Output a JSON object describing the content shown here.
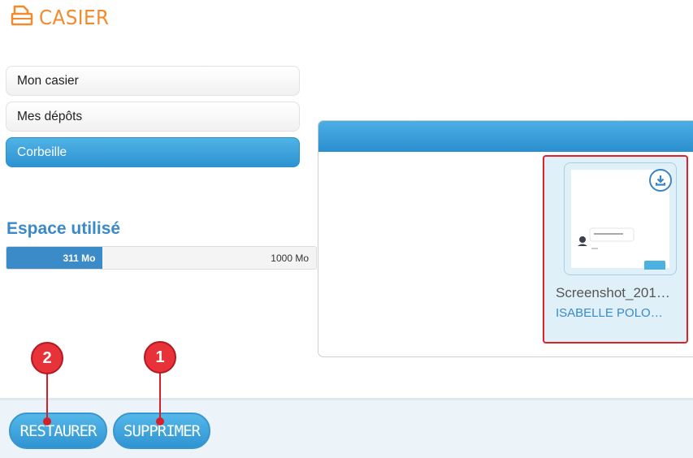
{
  "header": {
    "title": "CASIER",
    "icon": "locker-icon"
  },
  "nav": {
    "items": [
      {
        "label": "Mon casier",
        "active": false
      },
      {
        "label": "Mes dépôts",
        "active": false
      },
      {
        "label": "Corbeille",
        "active": true
      }
    ]
  },
  "storage": {
    "title": "Espace utilisé",
    "used_label": "311 Mo",
    "total_label": "1000 Mo",
    "used_fraction": 0.311
  },
  "file": {
    "name": "Screenshot_201…",
    "owner": "ISABELLE POLO…",
    "download_icon": "download-icon"
  },
  "footer": {
    "restore_label": "RESTAURER",
    "delete_label": "SUPPRIMER"
  },
  "markers": [
    {
      "number": "2",
      "target": "restore"
    },
    {
      "number": "1",
      "target": "delete"
    }
  ],
  "colors": {
    "accent": "#2d93d1",
    "title": "#f38a2c",
    "highlight": "#e2202a"
  }
}
